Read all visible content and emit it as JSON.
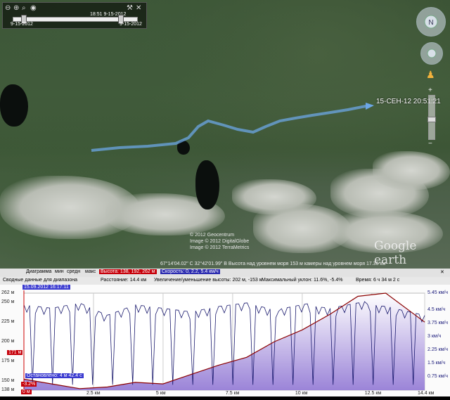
{
  "tour_slider": {
    "time_top": "18:51 9-15-2012",
    "range_start": "9-15-2012",
    "range_end": "9-15-2012"
  },
  "map": {
    "point_label": "15-СЕН-12 20:51:21",
    "copyright_lines": [
      "© 2012 Geocentrum",
      "Image © 2012 DigitalGlobe",
      "Image © 2012 TerraMetrics"
    ],
    "logo": "Google earth",
    "status": "67°14'04.02\" С  32°42'01.99\" В  Высота над уровнем моря  153 м  камеры над уровнем моря  17.36 км"
  },
  "profile": {
    "header": {
      "diagram_label": "Диаграмма",
      "min": "мин",
      "avg": "средн",
      "max": "макс",
      "altitude_pill": "Высота: 138, 192, 262 м",
      "speed_pill": "Скорость: 0, 2.2, 5.4 км/ч"
    },
    "summary": {
      "range_label": "Сводные данные для диапазона",
      "distance": "Расстояние: 14.4 км",
      "gain": "Увеличение/уменьшение высоты: 202 м, -153 м",
      "slope": "Максимальный уклон: 11.6%, -5.4%",
      "time": "Время: 6 ч 34 м 2 с"
    },
    "timestamp_tag": "15.09.2012 16:17:11",
    "cursor_altitude_tag": "171 м",
    "stopped_tag": "Остановлено: 4 м 42.4 с",
    "grade_tag": "-3.2%",
    "zero_tag": "0 м"
  },
  "chart_data": {
    "type": "area",
    "x": [
      0,
      1,
      2,
      3,
      4,
      5,
      6,
      7,
      8,
      9,
      10,
      11,
      12,
      13,
      14.4
    ],
    "xlabels": [
      "2.5 км",
      "5 км",
      "7.5 км",
      "10 км",
      "12.5 км",
      "14.4 км"
    ],
    "xticks": [
      2.5,
      5,
      7.5,
      10,
      12.5,
      14.4
    ],
    "xlim": [
      0,
      14.4
    ],
    "y_left_ticks": [
      "262 м",
      "250 м",
      "225 м",
      "200 м",
      "175 м",
      "150 м",
      "138 м"
    ],
    "y_right_ticks": [
      "5.45 км/ч",
      "4.5 км/ч",
      "3.75 км/ч",
      "3 км/ч",
      "2.25 км/ч",
      "1.5 км/ч",
      "0.75 км/ч"
    ],
    "ylim_altitude": [
      138,
      262
    ],
    "ylim_speed": [
      0,
      5.45
    ],
    "series": [
      {
        "name": "Высота",
        "unit": "м",
        "color": "#8b0000",
        "values": [
          152,
          146,
          140,
          142,
          148,
          146,
          158,
          170,
          180,
          200,
          215,
          235,
          258,
          262,
          225
        ]
      },
      {
        "name": "Скорость",
        "unit": "км/ч",
        "color": "#1a1a6e",
        "values": [
          4.8,
          4.6,
          4.9,
          4.2,
          4.8,
          4.6,
          4.4,
          4.7,
          4.9,
          4.5,
          4.8,
          4.6,
          4.9,
          4.7,
          4.2
        ]
      }
    ]
  }
}
